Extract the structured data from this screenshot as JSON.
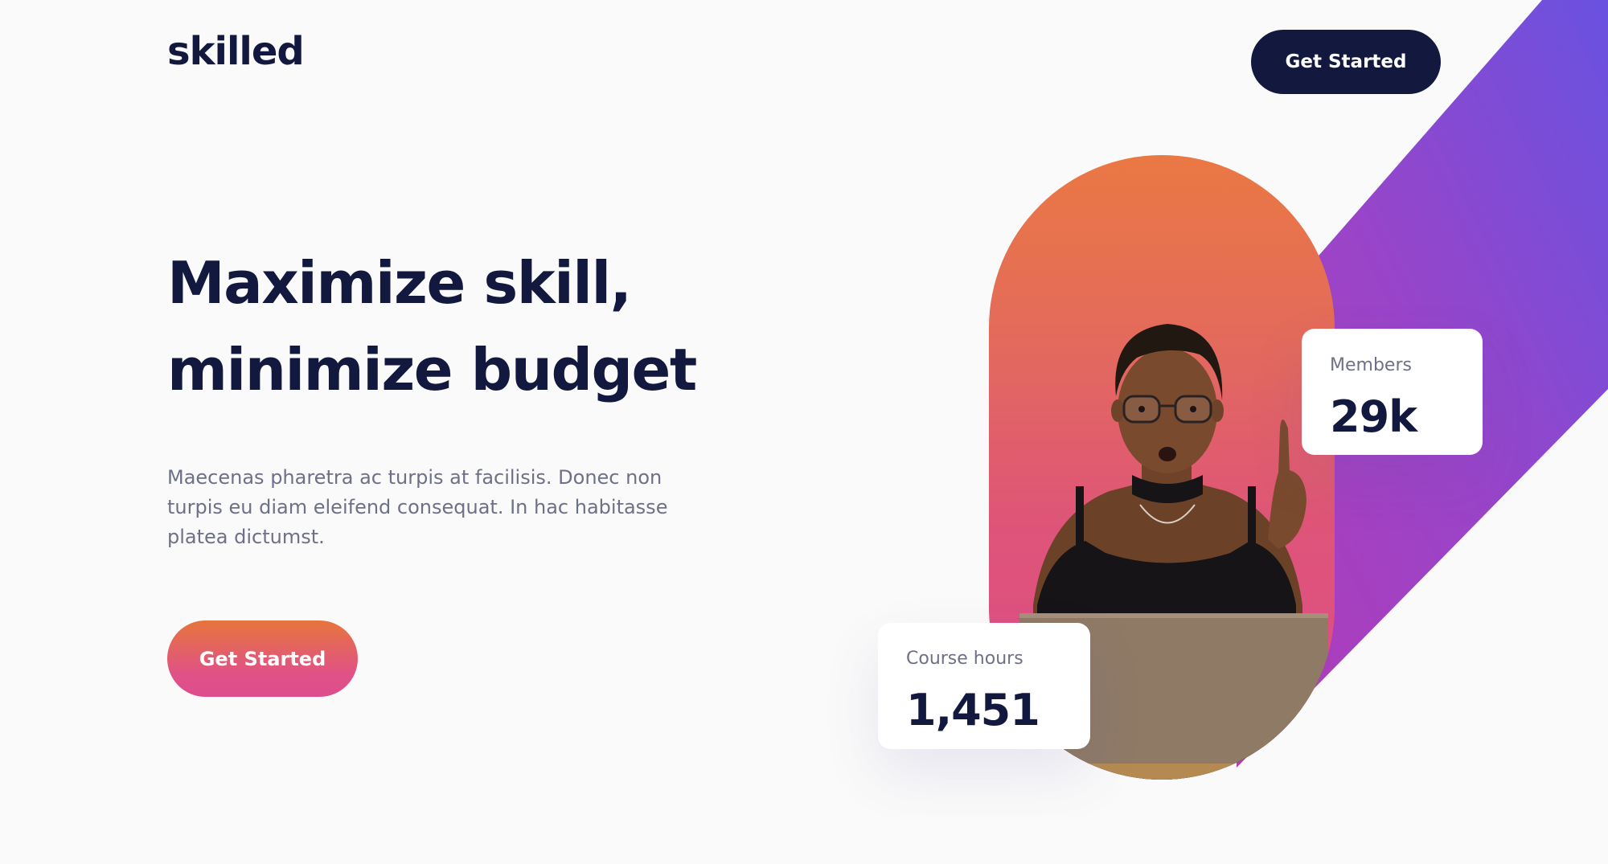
{
  "header": {
    "logo": "skilled",
    "cta_label": "Get Started"
  },
  "hero": {
    "title_line1": "Maximize skill,",
    "title_line2": "minimize budget",
    "description": "Maecenas pharetra ac turpis at facilisis. Donec non turpis eu diam eleifend consequat. In hac habitasse platea dictumst.",
    "cta_label": "Get Started"
  },
  "stats": {
    "members_label": "Members",
    "members_value": "29k",
    "hours_label": "Course hours",
    "hours_value": "1,451"
  },
  "colors": {
    "navy": "#13183f",
    "body_text": "#6e7087",
    "background": "#fafafa",
    "gradient_orange": "#ea7843",
    "gradient_pink": "#dc4c8b",
    "band_purple": "#a73fbd",
    "band_violet": "#6952e0"
  },
  "icons": {
    "hero_photo": "person-with-laptop-illustration"
  }
}
